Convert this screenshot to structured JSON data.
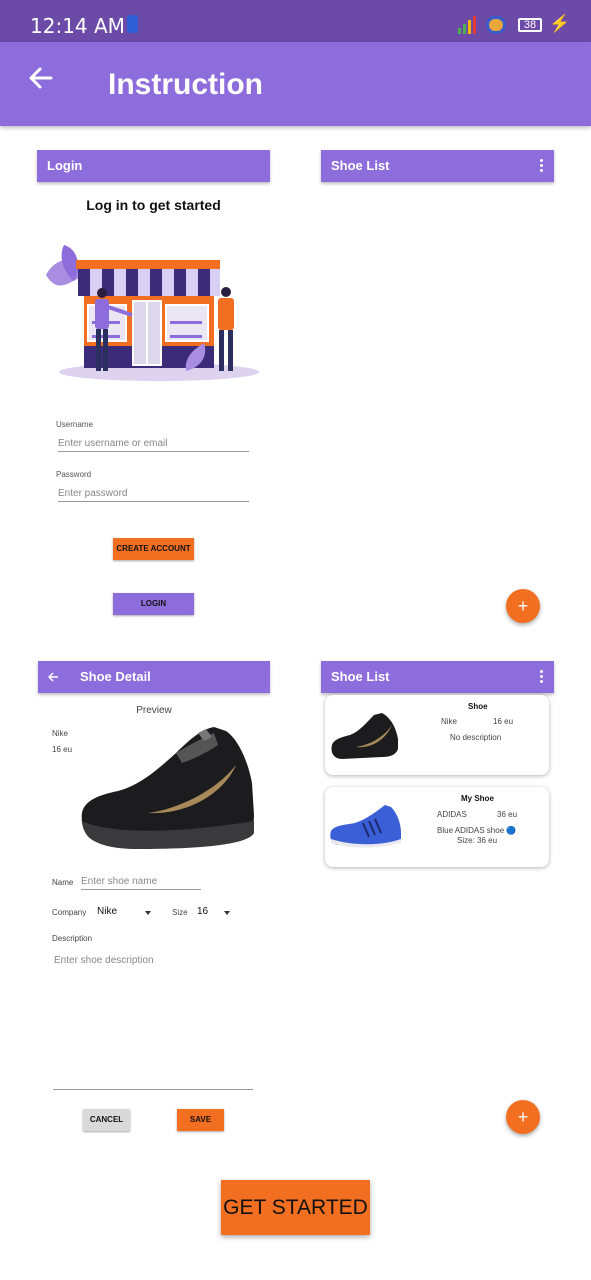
{
  "status_bar": {
    "time": "12:14 AM",
    "battery": "38"
  },
  "app_bar": {
    "title": "Instruction"
  },
  "login_panel": {
    "bar_title": "Login",
    "heading": "Log in to get started",
    "username_label": "Username",
    "username_placeholder": "Enter username or email",
    "password_label": "Password",
    "password_placeholder": "Enter password",
    "create_account": "CREATE ACCOUNT",
    "login": "LOGIN"
  },
  "shoe_list_empty": {
    "bar_title": "Shoe List",
    "fab": "+"
  },
  "shoe_detail": {
    "bar_title": "Shoe Detail",
    "preview_label": "Preview",
    "company": "Nike",
    "size": "16 eu",
    "name_label": "Name",
    "name_placeholder": "Enter shoe name",
    "company_label": "Company",
    "company_value": "Nike",
    "size_label": "Size",
    "size_value": "16",
    "description_label": "Description",
    "description_placeholder": "Enter shoe description",
    "cancel": "CANCEL",
    "save": "SAVE"
  },
  "shoe_list_filled": {
    "bar_title": "Shoe List",
    "fab": "+",
    "items": [
      {
        "name": "Shoe",
        "company": "Nike",
        "size": "16 eu",
        "description": "No description"
      },
      {
        "name": "My Shoe",
        "company": "ADIDAS",
        "size": "36 eu",
        "description": "Blue ADIDAS shoe 🔵",
        "size_line": "Size: 36 eu"
      }
    ]
  },
  "cta": {
    "label": "GET STARTED"
  },
  "colors": {
    "primary": "#8d6cdc",
    "status": "#6c4aa8",
    "accent": "#f26f21"
  }
}
